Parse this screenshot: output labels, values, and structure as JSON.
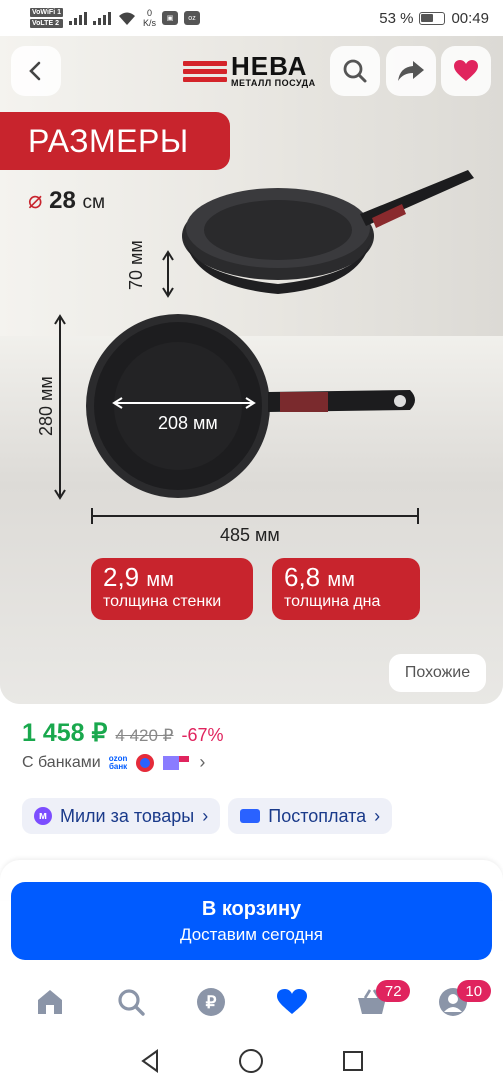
{
  "status_bar": {
    "tag1": "VoWiFi 1",
    "tag2": "VoLTE 2",
    "speed_value": "0",
    "speed_unit": "K/s",
    "battery": "53 %",
    "time": "00:49"
  },
  "hero": {
    "brand_name": "НЕВА",
    "brand_sub": "МЕТАЛЛ ПОСУДА",
    "banner": "РАЗМЕРЫ",
    "diameter_symbol": "⌀",
    "diameter_value": "28",
    "diameter_unit": "см",
    "height_label": "70 мм",
    "height_total_label": "280 мм",
    "inner_label": "208 мм",
    "length_label": "485 мм",
    "wall_value": "2,9",
    "wall_unit": "мм",
    "wall_caption": "толщина стенки",
    "bottom_value": "6,8",
    "bottom_unit": "мм",
    "bottom_caption": "толщина дна",
    "similar_label": "Похожие"
  },
  "product": {
    "price": "1 458 ₽",
    "old_price": "4 420 ₽",
    "discount": "-67%",
    "banks_label": "С банками",
    "ozon_bank_line1": "ozon",
    "ozon_bank_line2": "банк"
  },
  "chips": {
    "miles_label": "Мили за товары",
    "postpay_label": "Постоплата"
  },
  "cart": {
    "title": "В корзину",
    "subtitle": "Доставим сегодня"
  },
  "bottom_nav": {
    "cart_badge": "72",
    "profile_badge": "10"
  },
  "colors": {
    "accent_blue": "#005bff",
    "brand_red": "#c8242d",
    "price_green": "#19a84d",
    "discount_pink": "#e0245e"
  }
}
